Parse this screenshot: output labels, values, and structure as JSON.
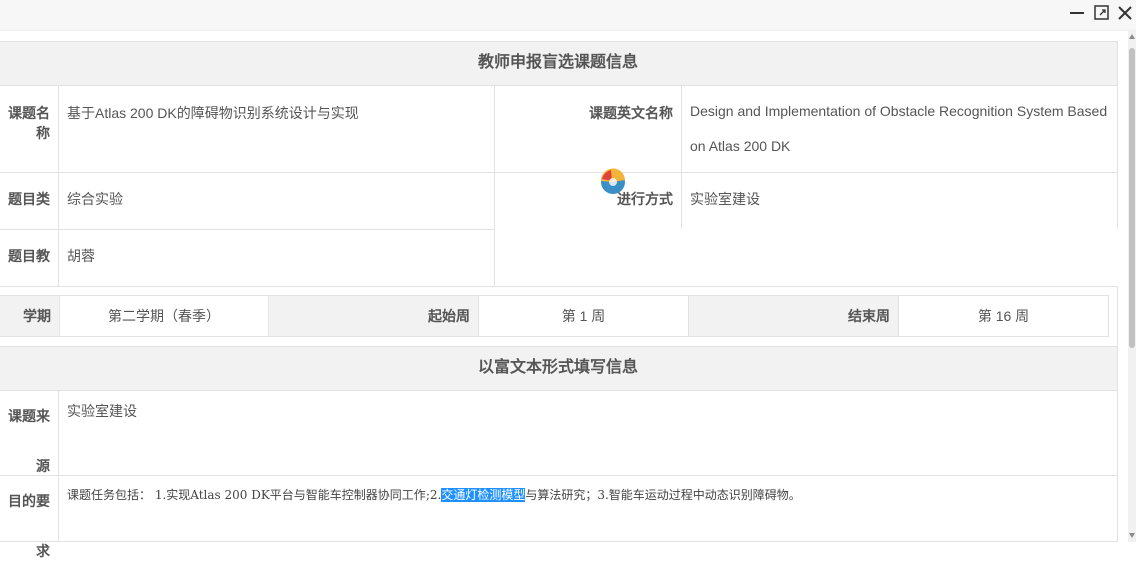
{
  "window": {
    "minimize_icon": "minimize-icon",
    "maximize_icon": "maximize-icon",
    "close_icon": "close-icon"
  },
  "section1": {
    "title": "教师申报盲选课题信息",
    "topic_name_label": "课题名称",
    "topic_name_value": "基于Atlas 200 DK的障碍物识别系统设计与实现",
    "topic_en_label": "课题英文名称",
    "topic_en_value_line1": "Design and Implementation of Obstacle Recognition System Based",
    "topic_en_value_line2": "on Atlas 200 DK",
    "topic_type_label": "题目类型",
    "topic_type_value": "综合实验",
    "method_label": "进行方式",
    "method_value": "实验室建设",
    "teacher_label": "题目教师",
    "teacher_value": "胡蓉"
  },
  "term": {
    "semester_label": "学期",
    "semester_value": "第二学期（春季）",
    "start_week_label": "起始周",
    "start_week_value": "第 1 周",
    "end_week_label": "结束周",
    "end_week_value": "第 16 周"
  },
  "section2": {
    "title": "以富文本形式填写信息",
    "source_label": "课题来源",
    "source_value": "实验室建设",
    "requirement_label": "目的要求",
    "requirement_before": "课题任务包括： 1.实现Atlas 200 DK平台与智能车控制器协同工作;2.",
    "requirement_highlight": "交通灯检测模型",
    "requirement_after": "与算法研究；3.智能车运动过程中动态识别障碍物。"
  },
  "colors": {
    "header_bg": "#f2f2f2",
    "border": "#e2e2e2",
    "highlight": "#1e90ff"
  }
}
